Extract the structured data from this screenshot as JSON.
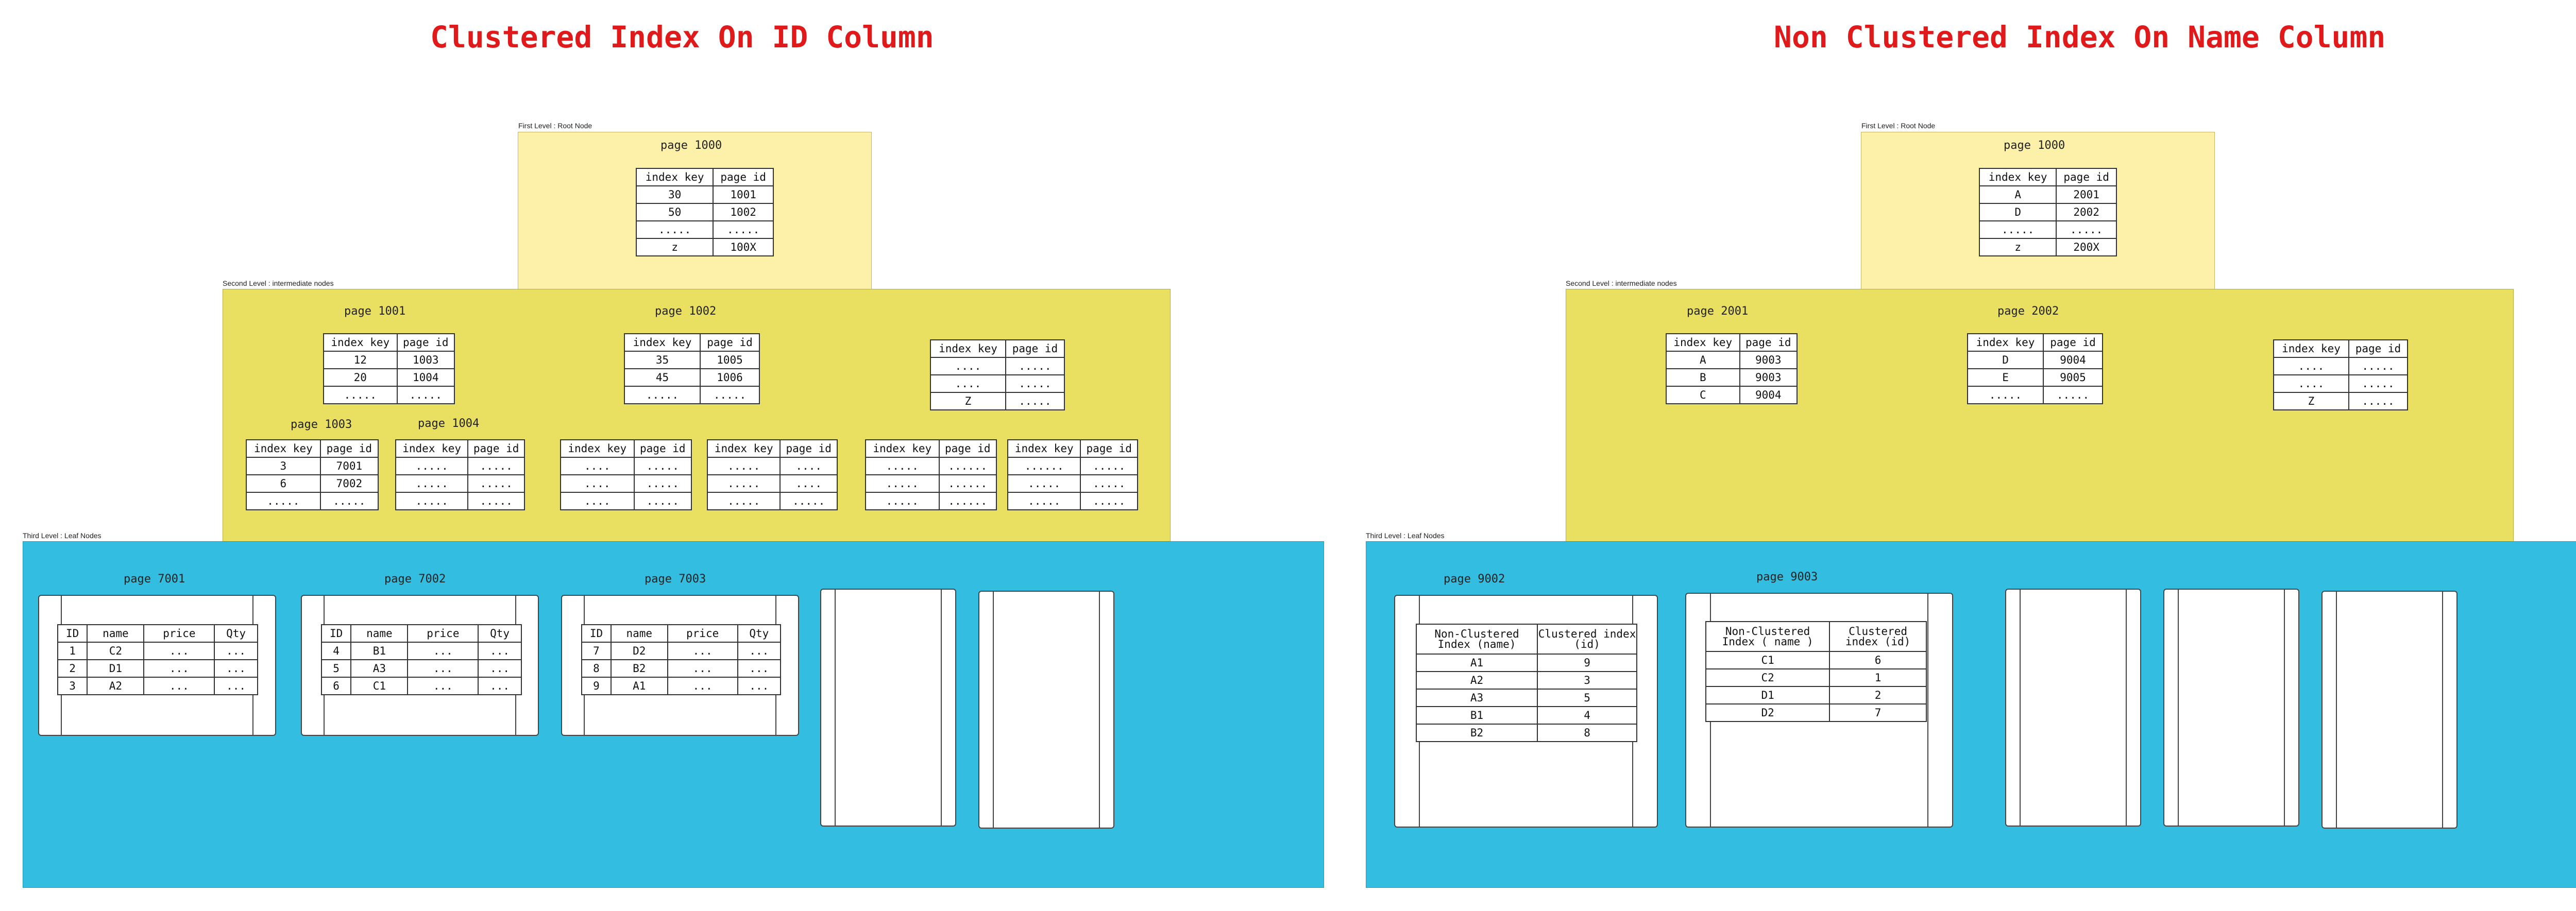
{
  "left": {
    "title": "Clustered Index On ID Column",
    "level1_label": "First Level : Root Node",
    "level2_label": "Second Level : intermediate nodes",
    "level3_label": "Third Level : Leaf Nodes",
    "root": {
      "page": "page 1000",
      "header": [
        "index key",
        "page id"
      ],
      "rows": [
        [
          "30",
          "1001"
        ],
        [
          "50",
          "1002"
        ],
        [
          ".....",
          "....."
        ],
        [
          "z",
          "100X"
        ]
      ]
    },
    "mid": {
      "p1001": {
        "page": "page 1001",
        "header": [
          "index key",
          "page id"
        ],
        "rows": [
          [
            "12",
            "1003"
          ],
          [
            "20",
            "1004"
          ],
          [
            ".....",
            "....."
          ]
        ]
      },
      "p1002": {
        "page": "page 1002",
        "header": [
          "index key",
          "page id"
        ],
        "rows": [
          [
            "35",
            "1005"
          ],
          [
            "45",
            "1006"
          ],
          [
            ".....",
            "....."
          ]
        ]
      },
      "p3": {
        "header": [
          "index key",
          "page id"
        ],
        "rows": [
          [
            "....",
            "....."
          ],
          [
            "....",
            "....."
          ],
          [
            "Z",
            "....."
          ]
        ]
      },
      "p1003": {
        "page": "page 1003",
        "header": [
          "index key",
          "page id"
        ],
        "rows": [
          [
            "3",
            "7001"
          ],
          [
            "6",
            "7002"
          ],
          [
            ".....",
            "....."
          ]
        ]
      },
      "p1004": {
        "page": "page 1004",
        "header": [
          "index key",
          "page id"
        ],
        "rows": [
          [
            ".....",
            "....."
          ],
          [
            ".....",
            "....."
          ],
          [
            ".....",
            "....."
          ]
        ]
      },
      "s3": {
        "header": [
          "index key",
          "page id"
        ],
        "rows": [
          [
            "....",
            "....."
          ],
          [
            "....",
            "....."
          ],
          [
            "....",
            "....."
          ]
        ]
      },
      "s4": {
        "header": [
          "index key",
          "page id"
        ],
        "rows": [
          [
            ".....",
            "...."
          ],
          [
            ".....",
            "...."
          ],
          [
            ".....",
            "....."
          ]
        ]
      },
      "s5": {
        "header": [
          "index key",
          "page id"
        ],
        "rows": [
          [
            ".....",
            "......"
          ],
          [
            ".....",
            "......"
          ],
          [
            ".....",
            "......"
          ]
        ]
      },
      "s6": {
        "header": [
          "index key",
          "page id"
        ],
        "rows": [
          [
            "......",
            "....."
          ],
          [
            ".....",
            "....."
          ],
          [
            ".....",
            "....."
          ]
        ]
      }
    },
    "leaf": {
      "p7001": {
        "page": "page 7001",
        "header": [
          "ID",
          "name",
          "price",
          "Qty"
        ],
        "rows": [
          [
            "1",
            "C2",
            "...",
            "..."
          ],
          [
            "2",
            "D1",
            "...",
            "..."
          ],
          [
            "3",
            "A2",
            "...",
            "..."
          ]
        ]
      },
      "p7002": {
        "page": "page 7002",
        "header": [
          "ID",
          "name",
          "price",
          "Qty"
        ],
        "rows": [
          [
            "4",
            "B1",
            "...",
            "..."
          ],
          [
            "5",
            "A3",
            "...",
            "..."
          ],
          [
            "6",
            "C1",
            "...",
            "..."
          ]
        ]
      },
      "p7003": {
        "page": "page 7003",
        "header": [
          "ID",
          "name",
          "price",
          "Qty"
        ],
        "rows": [
          [
            "7",
            "D2",
            "...",
            "..."
          ],
          [
            "8",
            "B2",
            "...",
            "..."
          ],
          [
            "9",
            "A1",
            "...",
            "..."
          ]
        ]
      }
    }
  },
  "right": {
    "title": "Non Clustered Index On Name Column",
    "level1_label": "First Level : Root Node",
    "level2_label": "Second Level : intermediate nodes",
    "level3_label": "Third Level : Leaf Nodes",
    "root": {
      "page": "page 1000",
      "header": [
        "index key",
        "page id"
      ],
      "rows": [
        [
          "A",
          "2001"
        ],
        [
          "D",
          "2002"
        ],
        [
          ".....",
          "....."
        ],
        [
          "z",
          "200X"
        ]
      ]
    },
    "mid": {
      "p2001": {
        "page": "page 2001",
        "header": [
          "index key",
          "page id"
        ],
        "rows": [
          [
            "A",
            "9003"
          ],
          [
            "B",
            "9003"
          ],
          [
            "C",
            "9004"
          ]
        ]
      },
      "p2002": {
        "page": "page 2002",
        "header": [
          "index key",
          "page id"
        ],
        "rows": [
          [
            "D",
            "9004"
          ],
          [
            "E",
            "9005"
          ],
          [
            ".....",
            "....."
          ]
        ]
      },
      "p3": {
        "header": [
          "index key",
          "page id"
        ],
        "rows": [
          [
            "....",
            "....."
          ],
          [
            "....",
            "....."
          ],
          [
            "Z",
            "....."
          ]
        ]
      }
    },
    "leaf": {
      "p9002": {
        "page": "page 9002",
        "header": [
          "Non-Clustered Index (name)",
          "Clustered index (id)"
        ],
        "rows": [
          [
            "A1",
            "9"
          ],
          [
            "A2",
            "3"
          ],
          [
            "A3",
            "5"
          ],
          [
            "B1",
            "4"
          ],
          [
            "B2",
            "8"
          ]
        ]
      },
      "p9003": {
        "page": "page 9003",
        "header": [
          "Non-Clustered Index ( name )",
          "Clustered index (id)"
        ],
        "rows": [
          [
            "C1",
            "6"
          ],
          [
            "C2",
            "1"
          ],
          [
            "D1",
            "2"
          ],
          [
            "D2",
            "7"
          ]
        ]
      }
    }
  }
}
